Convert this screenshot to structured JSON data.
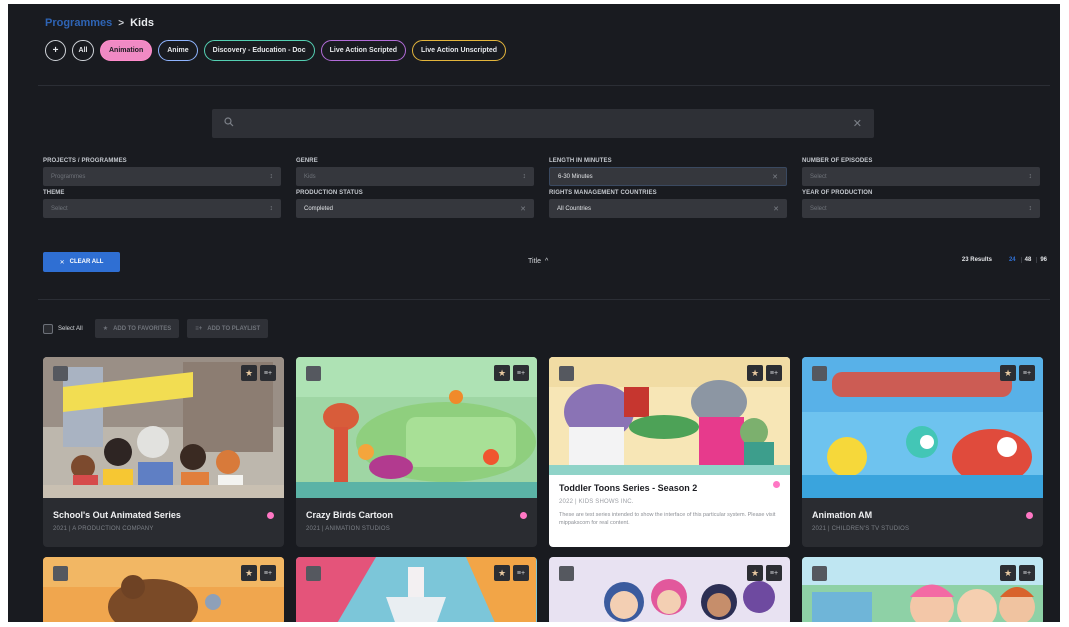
{
  "breadcrumb": {
    "root": "Programmes",
    "separator": ">",
    "current": "Kids"
  },
  "chips": [
    {
      "label": "+",
      "border": "#cfd3d8",
      "fill": "transparent",
      "text": "#e6e8eb",
      "cls": "round"
    },
    {
      "label": "All",
      "border": "#cfd3d8",
      "fill": "transparent",
      "text": "#e6e8eb",
      "cls": "all"
    },
    {
      "label": "Animation",
      "border": "#ff8ccb",
      "fill": "#f08ac4",
      "text": "#1a1b20",
      "cls": ""
    },
    {
      "label": "Anime",
      "border": "#8fb4ff",
      "fill": "transparent",
      "text": "#e6e8eb",
      "cls": ""
    },
    {
      "label": "Discovery - Education - Doc",
      "border": "#54d0b3",
      "fill": "transparent",
      "text": "#e6e8eb",
      "cls": ""
    },
    {
      "label": "Live Action Scripted",
      "border": "#b26cd8",
      "fill": "transparent",
      "text": "#e6e8eb",
      "cls": ""
    },
    {
      "label": "Live Action Unscripted",
      "border": "#e3b53c",
      "fill": "transparent",
      "text": "#e6e8eb",
      "cls": ""
    }
  ],
  "search": {
    "value": ""
  },
  "filters": [
    {
      "label": "PROJECTS / PROGRAMMES",
      "value": "Programmes",
      "dim": true,
      "control": "↕"
    },
    {
      "label": "GENRE",
      "value": "Kids",
      "dim": true,
      "control": "↕"
    },
    {
      "label": "LENGTH IN MINUTES",
      "value": "6-30 Minutes",
      "dim": false,
      "control": "✕",
      "highlight": true
    },
    {
      "label": "NUMBER OF EPISODES",
      "value": "Select",
      "dim": true,
      "control": "↕"
    },
    {
      "label": "THEME",
      "value": "Select",
      "dim": true,
      "control": "↕"
    },
    {
      "label": "PRODUCTION STATUS",
      "value": "Completed",
      "dim": false,
      "control": "✕"
    },
    {
      "label": "RIGHTS MANAGEMENT COUNTRIES",
      "value": "All Countries",
      "dim": false,
      "control": "✕"
    },
    {
      "label": "YEAR OF PRODUCTION",
      "value": "Select",
      "dim": true,
      "control": "↕"
    }
  ],
  "controls": {
    "clear_all": "CLEAR ALL",
    "sort_label": "Title",
    "sort_arrow": "^",
    "results": "23 Results",
    "page_sizes": [
      "24",
      "48",
      "96"
    ],
    "selected_page_size": "24"
  },
  "toolbar": {
    "select_all": "Select All",
    "add_favorites": "ADD TO FAVORITES",
    "add_playlist": "ADD TO PLAYLIST"
  },
  "cards": [
    {
      "title": "School's Out Animated Series",
      "sub": "2021 | A PRODUCTION COMPANY",
      "style": "dark",
      "dot": "#ff77c4",
      "art": "school"
    },
    {
      "title": "Crazy Birds Cartoon",
      "sub": "2021 | ANIMATION STUDIOS",
      "style": "dark",
      "dot": "#ff77c4",
      "art": "birds"
    },
    {
      "title": "Toddler Toons Series - Season 2",
      "sub": "2022 | KIDS SHOWS INC.",
      "style": "white",
      "dot": "#ff77c4",
      "desc": "These are test series intended to show the interface of this particular system. Please visit mippakscom for real content.",
      "art": "toddler"
    },
    {
      "title": "Animation AM",
      "sub": "2021 | CHILDREN'S TV STUDIOS",
      "style": "dark",
      "dot": "#ff77c4",
      "art": "am"
    },
    {
      "title": "",
      "sub": "",
      "style": "short",
      "art": "bear"
    },
    {
      "title": "",
      "sub": "",
      "style": "short",
      "art": "statue"
    },
    {
      "title": "",
      "sub": "",
      "style": "short",
      "art": "girls"
    },
    {
      "title": "",
      "sub": "",
      "style": "short",
      "art": "babies"
    }
  ],
  "icons": {
    "search": "search-icon",
    "clear": "close-icon",
    "favorite": "star-icon",
    "playlist": "playlist-add-icon"
  },
  "colors": {
    "accent": "#2f6fd3",
    "background": "#191b20",
    "genre_dot": "#ff77c4"
  }
}
